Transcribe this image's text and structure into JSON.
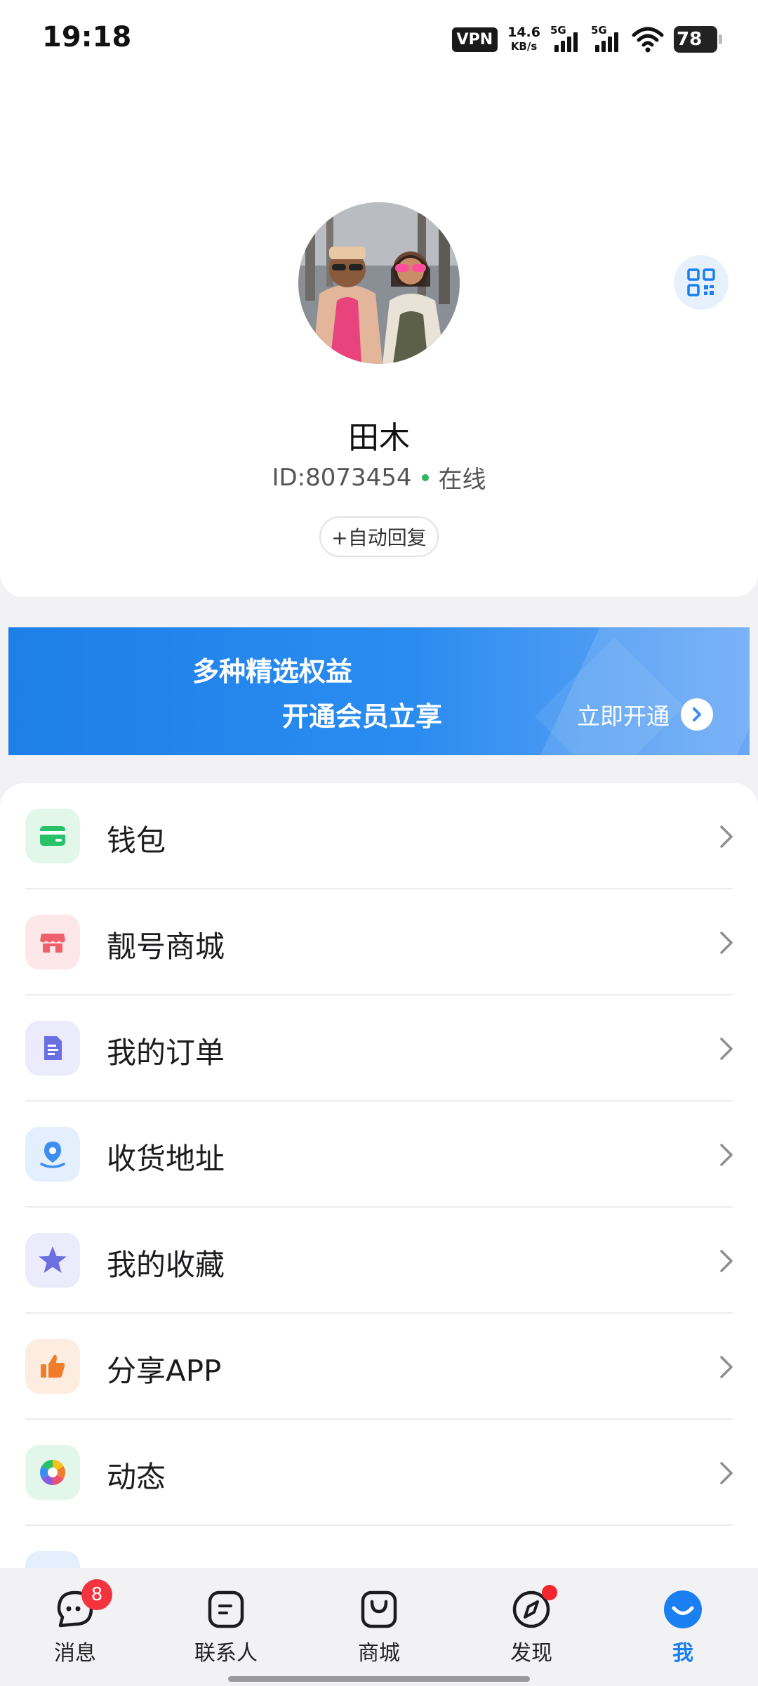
{
  "status_bar": {
    "time": "19:18",
    "vpn": "VPN",
    "speed_value": "14.6",
    "speed_unit": "KB/s",
    "sim1": "5G",
    "sim2": "5G",
    "battery": "78"
  },
  "profile": {
    "name": "田木",
    "id": "ID:8073454",
    "status": "在线",
    "auto_reply": "+自动回复"
  },
  "banner": {
    "line1": "多种精选权益",
    "line2": "开通会员立享",
    "cta": "立即开通"
  },
  "menu": [
    {
      "label": "钱包",
      "icon": "wallet-icon",
      "bg": "#e3f6ea",
      "color": "#27c26a"
    },
    {
      "label": "靓号商城",
      "icon": "shop-icon",
      "bg": "#fde7e9",
      "color": "#f0606c"
    },
    {
      "label": "我的订单",
      "icon": "order-document-icon",
      "bg": "#ebebfb",
      "color": "#6b6fe0"
    },
    {
      "label": "收货地址",
      "icon": "location-pin-icon",
      "bg": "#e3effd",
      "color": "#3d8ef2"
    },
    {
      "label": "我的收藏",
      "icon": "star-icon",
      "bg": "#ebebfb",
      "color": "#6b6fe0"
    },
    {
      "label": "分享APP",
      "icon": "thumbs-up-icon",
      "bg": "#fdece0",
      "color": "#f07d2c"
    },
    {
      "label": "动态",
      "icon": "aperture-icon",
      "bg": "#e3f6ea",
      "color": "#27c26a"
    }
  ],
  "nav": {
    "tabs": [
      {
        "label": "消息",
        "badge": "8"
      },
      {
        "label": "联系人"
      },
      {
        "label": "商城"
      },
      {
        "label": "发现"
      },
      {
        "label": "我"
      }
    ],
    "active_color": "#1a7ff0"
  }
}
